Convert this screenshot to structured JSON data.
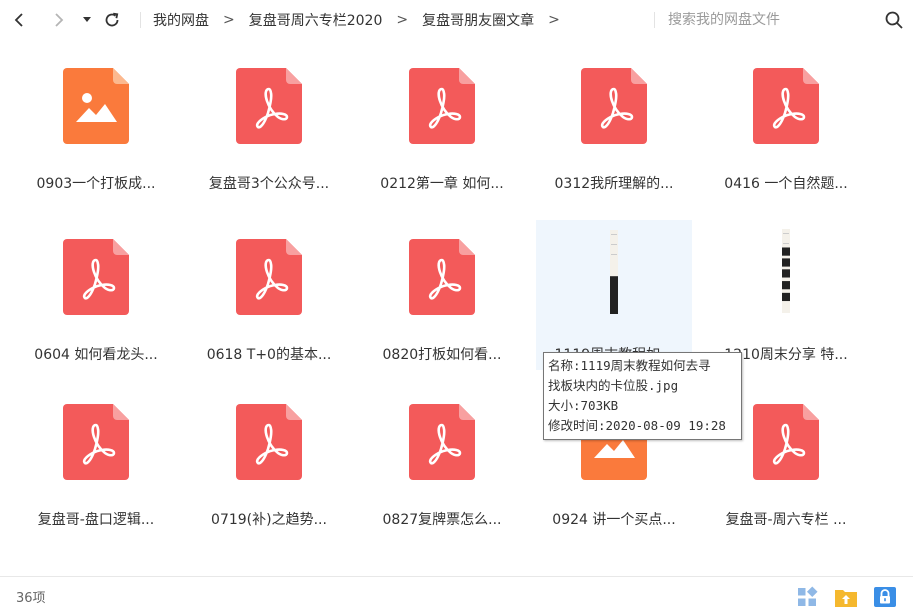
{
  "toolbar": {
    "back_icon": "back-arrow-icon",
    "forward_icon": "forward-arrow-icon",
    "history_icon": "history-dropdown-icon",
    "refresh_icon": "refresh-icon",
    "breadcrumbs": [
      "我的网盘",
      "复盘哥周六专栏2020",
      "复盘哥朋友圈文章"
    ],
    "breadcrumb_separator": ">",
    "search_placeholder": "搜索我的网盘文件",
    "search_value": "",
    "search_icon": "search-icon"
  },
  "files": [
    {
      "label": "0903一个打板成...",
      "type": "image"
    },
    {
      "label": "复盘哥3个公众号...",
      "type": "pdf"
    },
    {
      "label": "0212第一章 如何...",
      "type": "pdf"
    },
    {
      "label": "0312我所理解的...",
      "type": "pdf"
    },
    {
      "label": "0416 一个自然题...",
      "type": "pdf"
    },
    {
      "label": "0604 如何看龙头...",
      "type": "pdf"
    },
    {
      "label": "0618 T+0的基本...",
      "type": "pdf"
    },
    {
      "label": "0820打板如何看...",
      "type": "pdf"
    },
    {
      "label": "1119周末教程如...",
      "type": "thumbnail"
    },
    {
      "label": "1210周末分享 特...",
      "type": "thumbnail"
    },
    {
      "label": "复盘哥-盘口逻辑...",
      "type": "pdf"
    },
    {
      "label": "0719(补)之趋势...",
      "type": "pdf"
    },
    {
      "label": "0827复牌票怎么...",
      "type": "pdf"
    },
    {
      "label": "0924 讲一个买点...",
      "type": "image"
    },
    {
      "label": "复盘哥-周六专栏 ...",
      "type": "pdf"
    }
  ],
  "tooltip": {
    "line1": "名称:1119周末教程如何去寻",
    "line2": "找板块内的卡位股.jpg",
    "line3": "大小:703KB",
    "line4": "修改时间:2020-08-09 19:28"
  },
  "status": {
    "item_count": "36项",
    "view_toggle_icon": "grid-view-icon",
    "upload_icon": "upload-folder-icon",
    "lock_icon": "safe-box-lock-icon"
  },
  "colors": {
    "pdf_red": "#f35a5a",
    "image_orange": "#fa7a3c",
    "hover_bg": "#eff6fd",
    "accent_blue": "#3a8ee6"
  }
}
